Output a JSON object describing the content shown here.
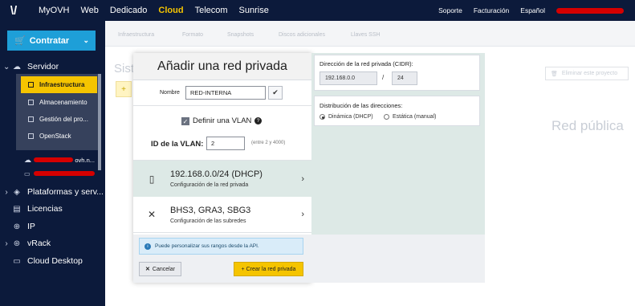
{
  "topbar": {
    "logo": "\\/",
    "nav": [
      "MyOVH",
      "Web",
      "Dedicado",
      "Cloud",
      "Telecom",
      "Sunrise"
    ],
    "active_nav": "Cloud",
    "right": [
      "Soporte",
      "Facturación",
      "Español"
    ]
  },
  "sidebar": {
    "contratar": "Contratar",
    "servidor": "Servidor",
    "subitems": [
      "Infraestructura",
      "Almacenamiento",
      "Gestión del pro...",
      "OpenStack"
    ],
    "domain1_suffix": "ovh.n...",
    "sections": [
      "Plataformas y serv...",
      "Licencias",
      "IP",
      "vRack",
      "Cloud Desktop"
    ]
  },
  "background": {
    "tabs": [
      "Infraestructura",
      "Formato",
      "Snapshots",
      "Discos adicionales",
      "Llaves SSH"
    ],
    "section_title": "Sist",
    "delete_project": "Eliminar este proyecto",
    "public_network": "Red pública"
  },
  "modal": {
    "title": "Añadir una red privada",
    "name_label": "Nombre",
    "name_value": "RED-INTERNA",
    "vlan_checkbox_label": "Definir una VLAN",
    "vlan_id_label": "ID de la VLAN:",
    "vlan_id_value": "2",
    "vlan_range_hint": "(entre 2 y 4000)",
    "options": [
      {
        "title": "192.168.0.0/24 (DHCP)",
        "subtitle": "Configuración de la red privada"
      },
      {
        "title": "BHS3, GRA3, SBG3",
        "subtitle": "Configuración de las subredes"
      }
    ],
    "info_text": "Puede personalizar sus rangos desde la API.",
    "cancel_label": "Cancelar",
    "create_label": "+ Crear la red privada",
    "cidr_label": "Dirección de la red privada (CIDR):",
    "cidr_address": "192.168.0.0",
    "cidr_separator": "/",
    "cidr_mask": "24",
    "distribution_label": "Distribución de las direcciones:",
    "distribution_options": [
      "Dinámica (DHCP)",
      "Estática (manual)"
    ],
    "distribution_selected": "Dinámica (DHCP)"
  },
  "colors": {
    "topbar_bg": "#0c1a3b",
    "accent_yellow": "#f5c400",
    "contratar_blue": "#1e9fd8",
    "selected_option_bg": "#dde9e6"
  }
}
